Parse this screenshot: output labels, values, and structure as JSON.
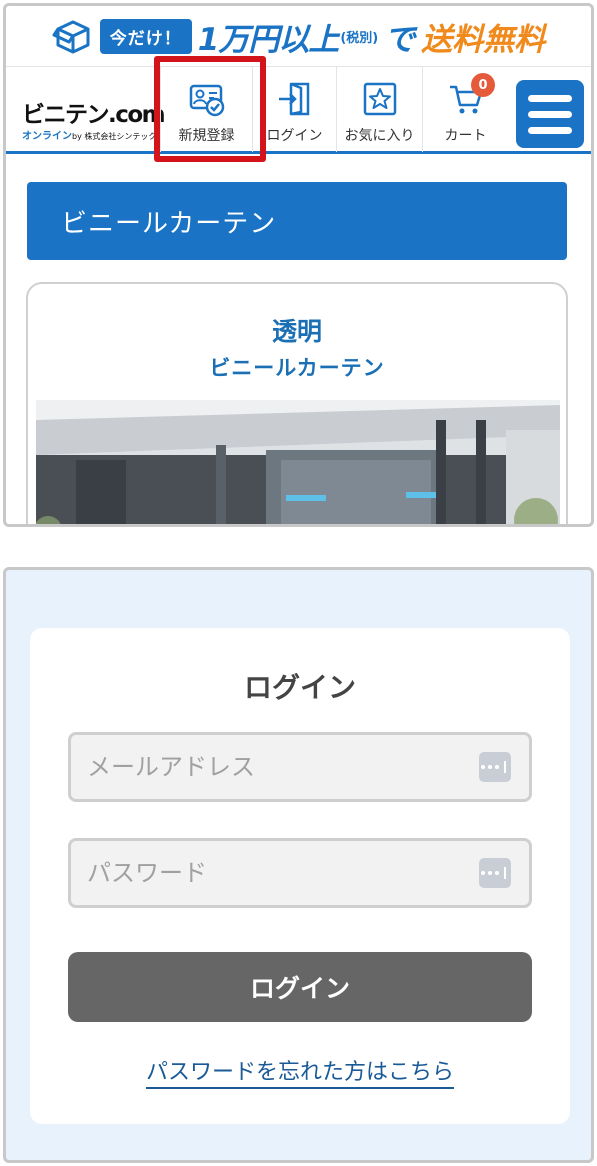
{
  "promo": {
    "pill": "今だけ！",
    "amount": "1万円以上",
    "tax_note": "(税別)",
    "particle": "で",
    "free_shipping": "送料無料"
  },
  "header": {
    "logo_main": "ビニテン.com",
    "logo_sub": "オンライン",
    "logo_by": "by 株式会社シンテック",
    "nav": {
      "signup": "新規登録",
      "login": "ログイン",
      "favorites": "お気に入り",
      "cart": "カート",
      "cart_count": "0"
    }
  },
  "category_banner": "ビニールカーテン",
  "product_card": {
    "title_line1": "透明",
    "title_line2": "ビニールカーテン"
  },
  "login": {
    "title": "ログイン",
    "email_placeholder": "メールアドレス",
    "email_value": "",
    "password_placeholder": "パスワード",
    "password_value": "",
    "button": "ログイン",
    "forgot_link": "パスワードを忘れた方はこちら"
  },
  "colors": {
    "brand_blue": "#1a73c4",
    "highlight_red": "#d4141b",
    "promo_orange": "#f08a1c",
    "login_button": "#666666",
    "panel_bg": "#e8f2fc"
  }
}
